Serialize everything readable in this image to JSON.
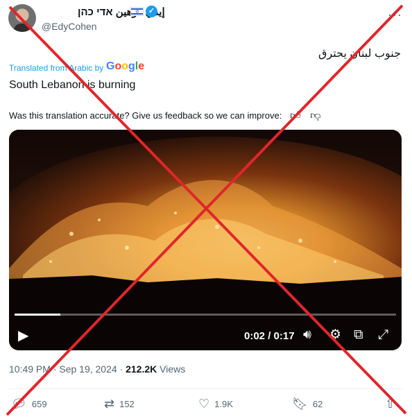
{
  "author": {
    "display_name": "إيدي كوهين אדי כהן",
    "handle": "@EdyCohen"
  },
  "icons": {
    "flag": "israel-flag-icon",
    "verified": "verified-badge-icon",
    "more": "more-options-icon",
    "play": "play-icon",
    "volume": "volume-icon",
    "settings": "settings-gear-icon",
    "pip": "picture-in-picture-icon",
    "fullscreen": "fullscreen-icon",
    "reply": "reply-icon",
    "retweet": "retweet-icon",
    "like": "heart-icon",
    "bookmark": "bookmark-icon",
    "share": "share-icon"
  },
  "tweet": {
    "original_text": "جنوب لبنان يحترق",
    "translated_label": "Translated from Arabic by",
    "translator": "Google",
    "translation": "South Lebanon is burning",
    "feedback_prompt": "Was this translation accurate? Give us feedback so we can improve:",
    "timestamp": "10:49 PM · Sep 19, 2024 · ",
    "views_count": "212.2K",
    "views_label": " Views"
  },
  "video": {
    "time_display": "0:02 / 0:17",
    "progress_fraction": 0.12
  },
  "actions": {
    "replies": "659",
    "retweets": "152",
    "likes": "1.9K",
    "bookmarks": "62"
  },
  "colors": {
    "accent": "#1d9bf0",
    "cross": "#e0262b",
    "muted_text": "#536471"
  }
}
